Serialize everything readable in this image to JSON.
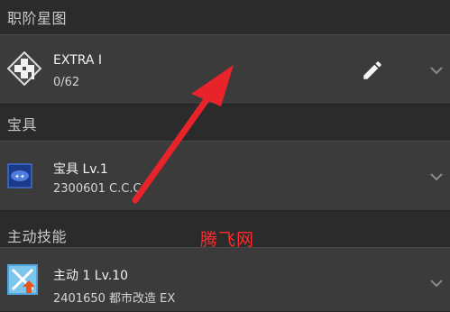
{
  "sections": {
    "astro": {
      "header": "职阶星图",
      "title": "EXTRA I",
      "sub": "0/62"
    },
    "np": {
      "header": "宝具",
      "title": "宝具 Lv.1",
      "sub": "2300601 C.C.C"
    },
    "active": {
      "header": "主动技能",
      "title": "主动 1 Lv.10",
      "sub": "2401650 都市改造 EX"
    }
  },
  "watermark": "腾飞网",
  "icons": {
    "astro": "dpad-icon",
    "edit": "pencil-icon",
    "expand": "chevron-down-icon"
  },
  "colors": {
    "background": "#2b2b2b",
    "row": "#3b3b3b",
    "arrow": "#e8232a",
    "watermark": "#ff2a2a"
  }
}
